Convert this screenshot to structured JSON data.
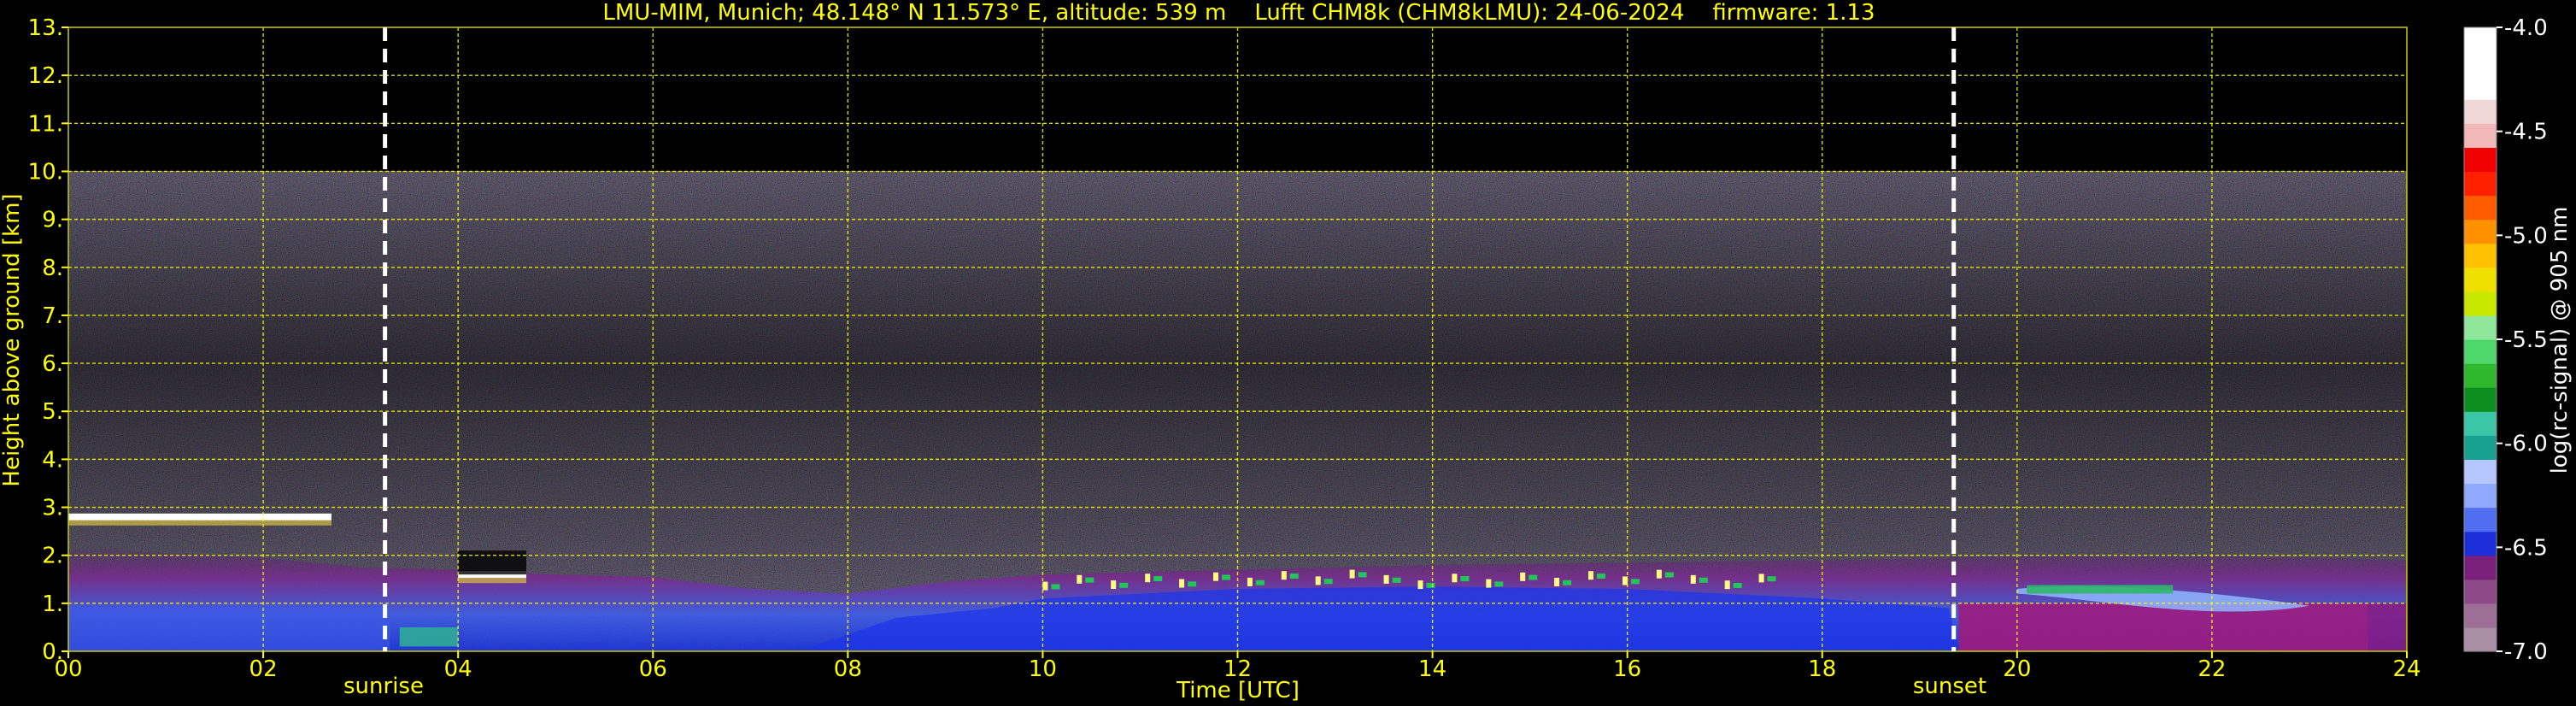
{
  "chart_data": {
    "type": "heatmap",
    "title": "LMU-MIM, Munich; 48.148° N 11.573° E, altitude: 539 m    Lufft CHM8k (CHM8kLMU): 24-06-2024    firmware: 1.13",
    "xlabel": "Time [UTC]",
    "ylabel": "Height above ground [km]",
    "xlim": [
      0,
      24
    ],
    "ylim": [
      0,
      13
    ],
    "x_ticks": [
      "00",
      "02",
      "04",
      "06",
      "08",
      "10",
      "12",
      "14",
      "16",
      "18",
      "20",
      "22",
      "24"
    ],
    "y_ticks": [
      "0.",
      "1.",
      "2.",
      "3.",
      "4.",
      "5.",
      "6.",
      "7.",
      "8.",
      "9.",
      "10.",
      "11.",
      "12.",
      "13."
    ],
    "grid": true,
    "signal_top_km": 10,
    "sunrise": {
      "label": "sunrise",
      "time": 3.25
    },
    "sunset": {
      "label": "sunset",
      "time": 19.35
    },
    "colorbar": {
      "label": "log(rc-signal) @ 905 nm",
      "range": [
        -7.0,
        -4.0
      ],
      "ticks": [
        "-4.0",
        "-4.5",
        "-5.0",
        "-5.5",
        "-6.0",
        "-6.5",
        "-7.0"
      ],
      "colors": [
        "#a88fa3",
        "#9d6f97",
        "#8e4a88",
        "#7a1f7a",
        "#1d2fd8",
        "#4f6ff0",
        "#8fa9ff",
        "#b6c6ff",
        "#18a090",
        "#3cc6a8",
        "#0d8f1f",
        "#2fb82e",
        "#4fd86a",
        "#8fe89a",
        "#c8e800",
        "#f0e000",
        "#ffc000",
        "#ff9000",
        "#ff5c00",
        "#ff2000",
        "#f00000",
        "#f0b8b8",
        "#f0d8d8",
        "#ffffff",
        "#ffffff",
        "#ffffff"
      ]
    },
    "layers": [
      {
        "name": "cloud",
        "t0": 0.0,
        "t1": 2.7,
        "h": 2.8,
        "color": "#ffffff"
      },
      {
        "name": "cloud",
        "t0": 4.0,
        "t1": 4.7,
        "h": 1.6,
        "color": "#ffffff"
      },
      {
        "name": "cloud_spots",
        "t0": 10.0,
        "t1": 17.6,
        "h": 1.55,
        "color": "#fffb80"
      }
    ]
  }
}
